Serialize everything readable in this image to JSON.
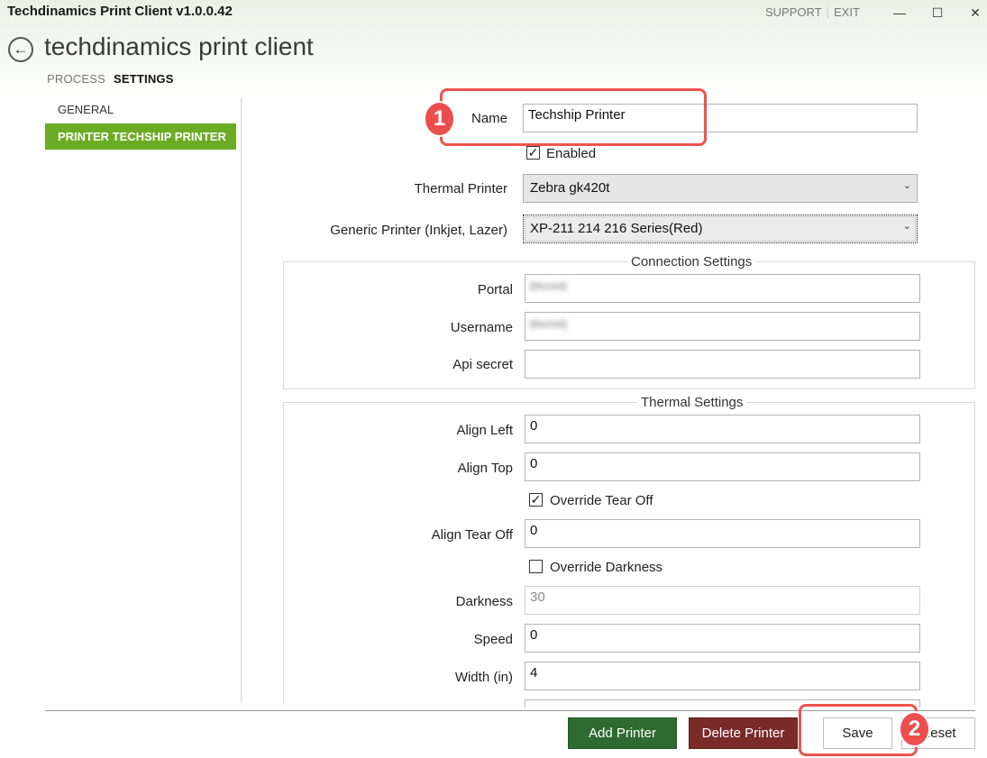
{
  "app": {
    "title": "Techdinamics Print Client v1.0.0.42",
    "heading": "techdinamics print client",
    "links": {
      "support": "SUPPORT",
      "separator": "|",
      "exit": "EXIT"
    },
    "window": {
      "minimize": "—",
      "maximize": "☐",
      "close": "✕"
    },
    "back_icon": "←"
  },
  "tabs": [
    {
      "label": "PROCESS",
      "active": false
    },
    {
      "label": "SETTINGS",
      "active": true
    }
  ],
  "nav": {
    "items": [
      {
        "label": "GENERAL",
        "active": false
      },
      {
        "label": "PRINTER TECHSHIP PRINTER",
        "active": true
      }
    ],
    "active_color": "#6cac25"
  },
  "form": {
    "name": {
      "label": "Name",
      "value": "Techship Printer"
    },
    "enabled": {
      "label": "Enabled",
      "checked": true
    },
    "thermal_printer": {
      "label": "Thermal Printer",
      "value": "Zebra gk420t"
    },
    "generic_printer": {
      "label": "Generic Printer (Inkjet, Lazer)",
      "value": "XP-211 214 216 Series(Red)"
    }
  },
  "connection_settings": {
    "title": "Connection Settings",
    "portal": {
      "label": "Portal",
      "value": "[blurred]"
    },
    "username": {
      "label": "Username",
      "value": "[blurred]"
    },
    "api_secret": {
      "label": "Api secret",
      "value": ""
    }
  },
  "thermal_settings": {
    "title": "Thermal Settings",
    "align_left": {
      "label": "Align Left",
      "value": "0"
    },
    "align_top": {
      "label": "Align Top",
      "value": "0"
    },
    "override_tear_off": {
      "label": "Override Tear Off",
      "checked": true
    },
    "align_tear_off": {
      "label": "Align Tear Off",
      "value": "0"
    },
    "override_darkness": {
      "label": "Override Darkness",
      "checked": false
    },
    "darkness": {
      "label": "Darkness",
      "value": "30"
    },
    "speed": {
      "label": "Speed",
      "value": "0"
    },
    "width": {
      "label": "Width (in)",
      "value": "4"
    }
  },
  "buttons": {
    "add_printer": "Add Printer",
    "delete_printer": "Delete Printer",
    "save": "Save",
    "reset": "Reset"
  },
  "annotations": {
    "badge1": "1",
    "badge2": "2",
    "color": "#ef5350"
  },
  "checkmark": "✓",
  "chevron": "⌄",
  "colors": {
    "add": "#2e6b30",
    "delete": "#7b2a2a"
  }
}
